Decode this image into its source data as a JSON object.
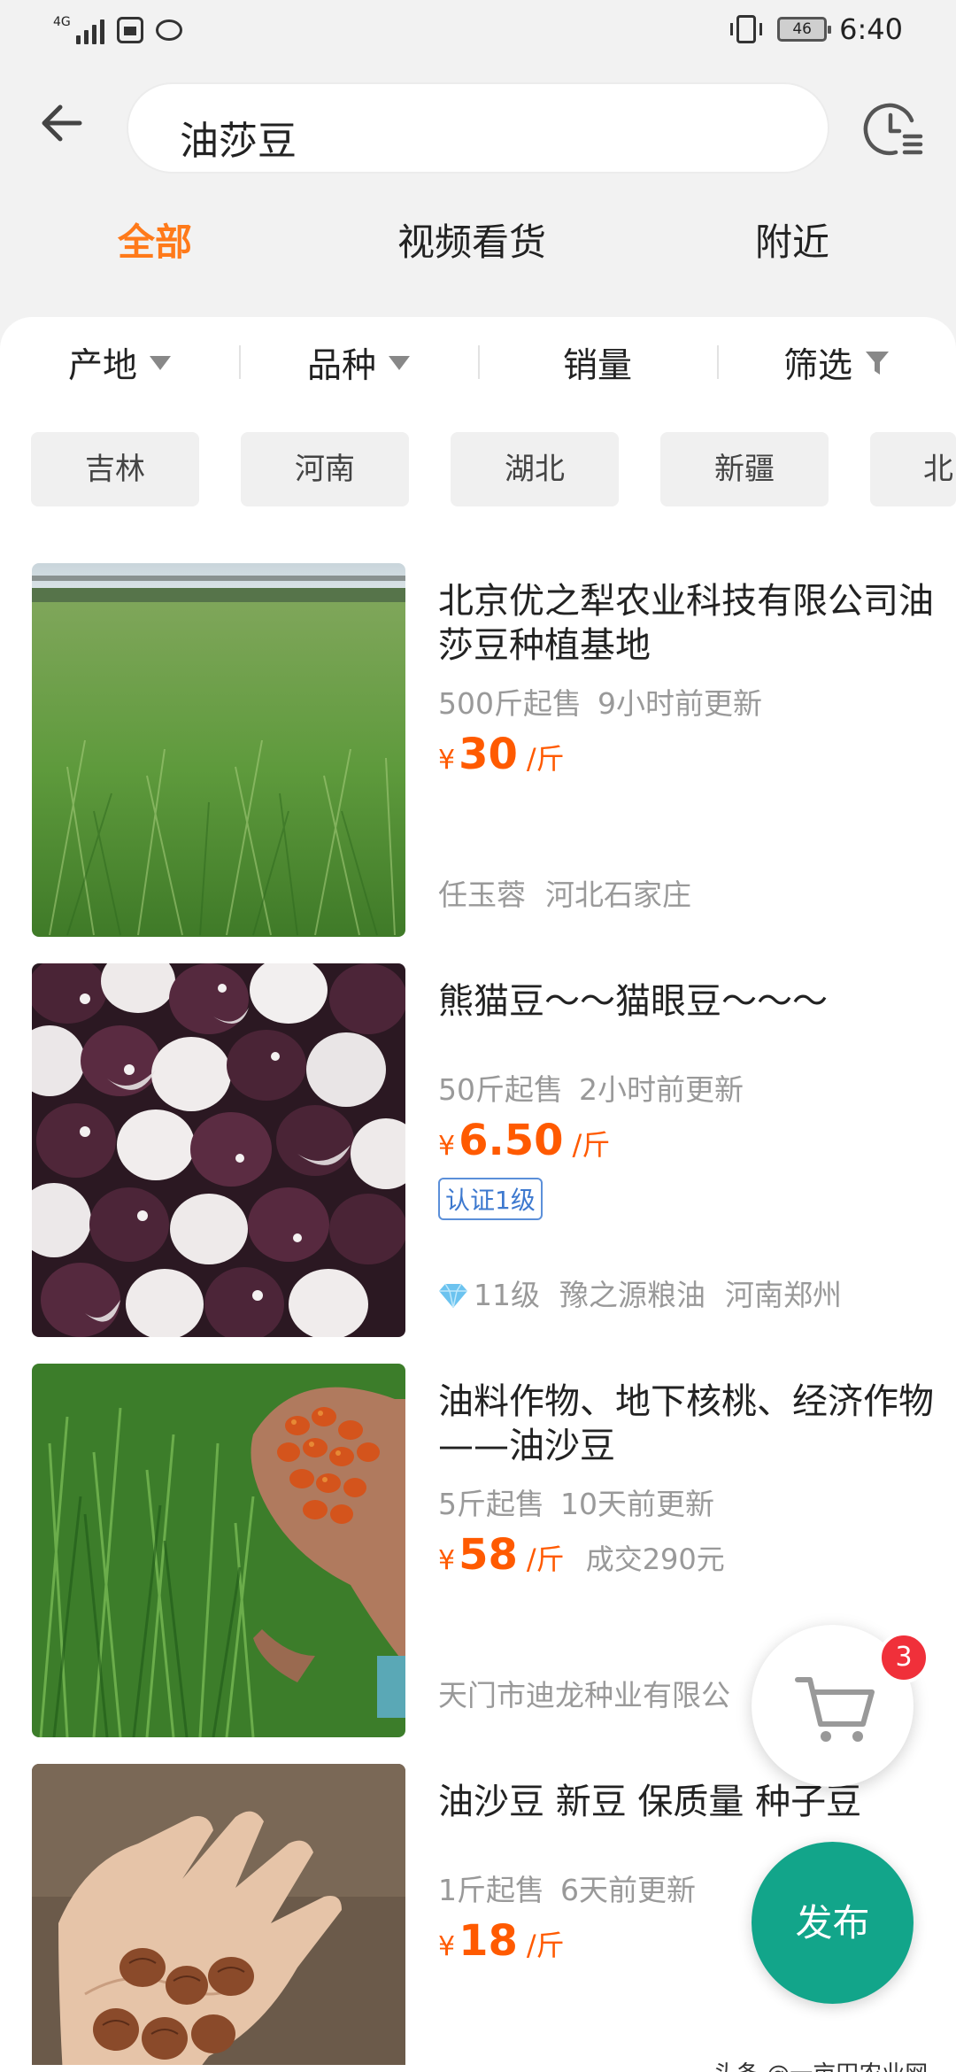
{
  "status_bar": {
    "network": "4G",
    "battery": "46",
    "time": "6:40"
  },
  "search": {
    "query": "油莎豆"
  },
  "tabs": [
    {
      "label": "全部",
      "active": true
    },
    {
      "label": "视频看货",
      "active": false
    },
    {
      "label": "附近",
      "active": false
    }
  ],
  "filters": [
    {
      "label": "产地"
    },
    {
      "label": "品种"
    },
    {
      "label": "销量"
    },
    {
      "label": "筛选"
    }
  ],
  "regions": [
    "吉林",
    "河南",
    "湖北",
    "新疆",
    "北"
  ],
  "listings": [
    {
      "title": "北京优之犁农业科技有限公司油莎豆种植基地",
      "min_order": "500斤起售",
      "updated": "9小时前更新",
      "currency": "¥",
      "price": "30",
      "unit": "/斤",
      "seller_name": "任玉蓉",
      "location": "河北石家庄"
    },
    {
      "title": "熊猫豆～～猫眼豆～～～",
      "min_order": "50斤起售",
      "updated": "2小时前更新",
      "currency": "¥",
      "price": "6.50",
      "unit": "/斤",
      "badge": "认证1级",
      "seller_level": "11级",
      "seller_name": "豫之源粮油",
      "location": "河南郑州"
    },
    {
      "title": "油料作物、地下核桃、经济作物——油沙豆",
      "min_order": "5斤起售",
      "updated": "10天前更新",
      "currency": "¥",
      "price": "58",
      "unit": "/斤",
      "deal": "成交290元",
      "seller_name": "天门市迪龙种业有限公"
    },
    {
      "title": "油沙豆 新豆 保质量 种子豆",
      "min_order": "1斤起售",
      "updated": "6天前更新",
      "currency": "¥",
      "price": "18",
      "unit": "/斤"
    }
  ],
  "cart": {
    "count": "3"
  },
  "publish": {
    "label": "发布"
  },
  "watermark": "头条 @一亩田农业网",
  "colors": {
    "accent": "#ff7a1a",
    "price": "#ff5a00",
    "publish": "#12a58a",
    "badge": "#f0303a"
  }
}
